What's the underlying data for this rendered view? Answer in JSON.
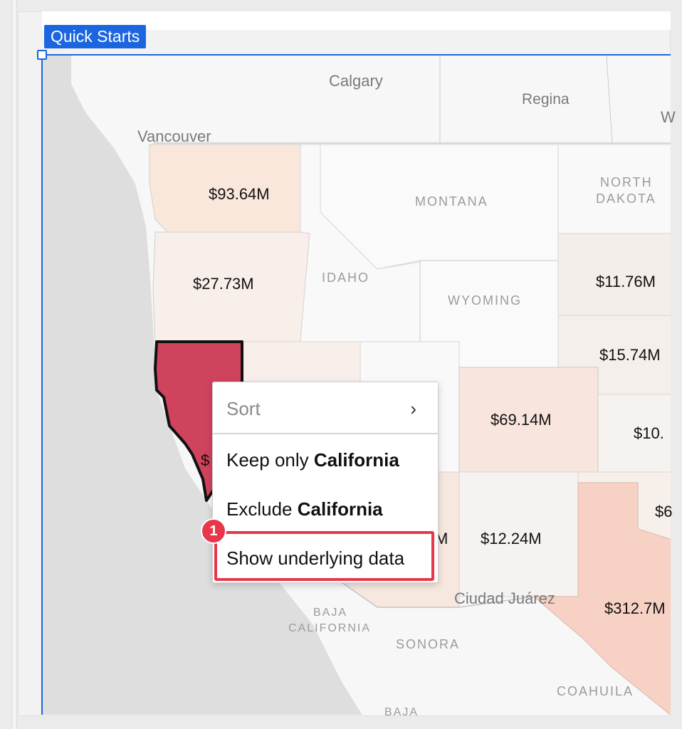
{
  "canvas": {
    "tag": "Quick Starts"
  },
  "map": {
    "values": {
      "washington": "$93.64M",
      "oregon": "$27.73M",
      "california": "$",
      "colorado": "$69.14M",
      "new_mexico": "$12.24M",
      "texas": "$312.7M",
      "north_dakota": "$11.76M",
      "south_dakota": "$15.74M",
      "nebraska": "$10.",
      "oklahoma": "$6",
      "arizona": "M"
    },
    "regions": {
      "montana": "MONTANA",
      "idaho": "IDAHO",
      "wyoming": "WYOMING",
      "north_dakota_line1": "NORTH",
      "north_dakota_line2": "DAKOTA",
      "baja_line1": "BAJA",
      "baja_line2": "CALIFORNIA",
      "sonora": "SONORA",
      "coahuila": "COAHUILA",
      "baja_bottom": "BAJA"
    },
    "cities": {
      "calgary": "Calgary",
      "regina": "Regina",
      "vancouver": "Vancouver",
      "ciudad_juarez": "Ciudad Juárez",
      "w_partial": "W"
    }
  },
  "context_menu": {
    "sort_label": "Sort",
    "keep_prefix": "Keep only ",
    "keep_target": "California",
    "exclude_prefix": "Exclude ",
    "exclude_target": "California",
    "show_data": "Show underlying data",
    "step_badge": "1"
  },
  "colors": {
    "accent": "#1b66e0",
    "highlight": "#e8374a",
    "selected_state": "#d0435c",
    "ocean": "#dedede",
    "land": "#f7f7f7"
  }
}
